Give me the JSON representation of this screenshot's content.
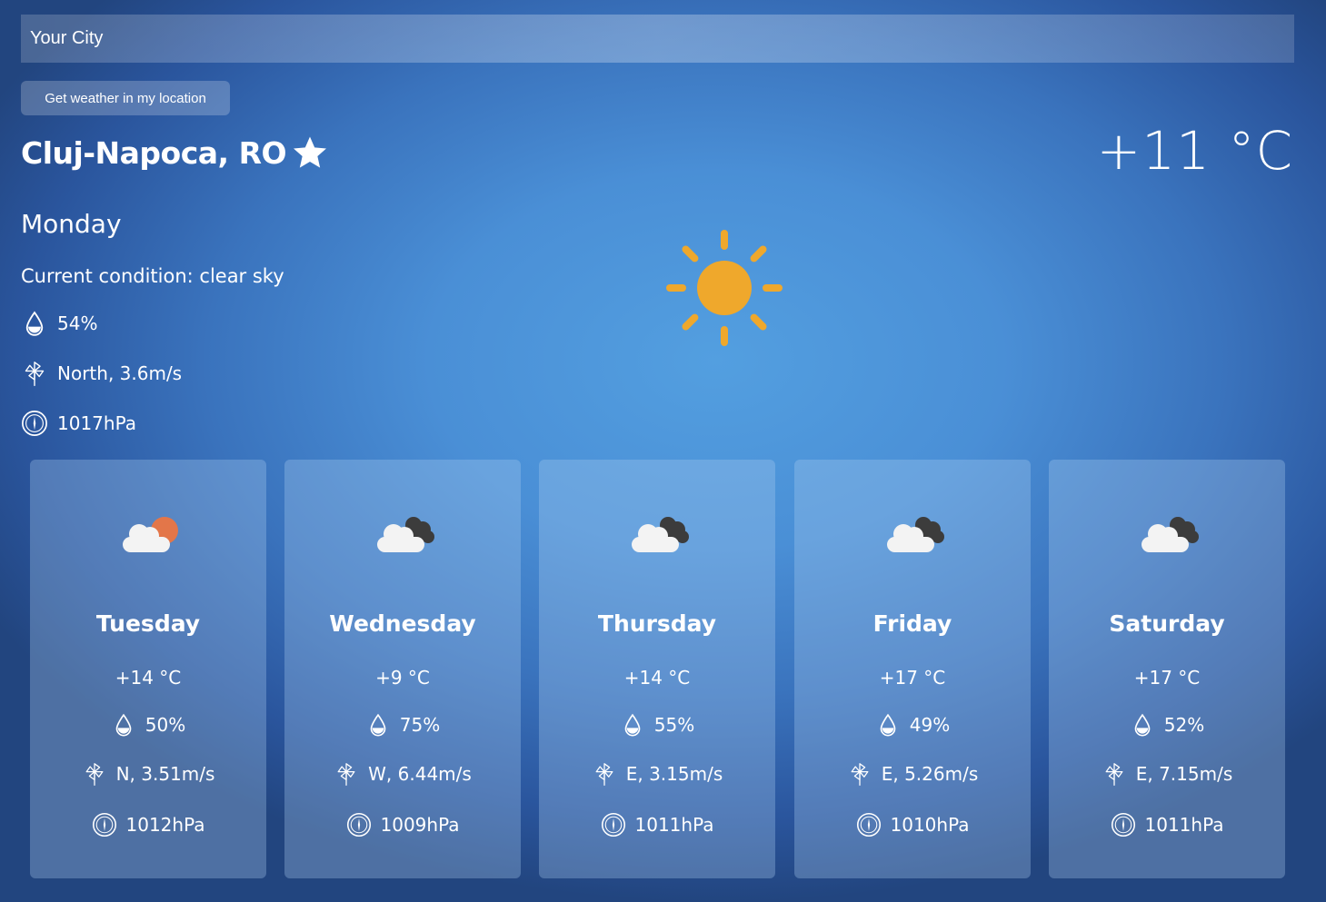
{
  "search": {
    "placeholder": "Your City"
  },
  "location_button": {
    "label": "Get weather in my location"
  },
  "current": {
    "city": "Cluj-Napoca, RO",
    "temperature": "+11 °C",
    "day": "Monday",
    "condition": "Current condition: clear sky",
    "humidity": "54%",
    "wind": "North, 3.6m/s",
    "pressure": "1017hPa",
    "icon": "sun-icon"
  },
  "forecast": [
    {
      "day": "Tuesday",
      "temp": "+14 °C",
      "humidity": "50%",
      "wind": "N, 3.51m/s",
      "pressure": "1012hPa",
      "icon": "cloud-sun-icon"
    },
    {
      "day": "Wednesday",
      "temp": "+9 °C",
      "humidity": "75%",
      "wind": "W, 6.44m/s",
      "pressure": "1009hPa",
      "icon": "cloud-icon"
    },
    {
      "day": "Thursday",
      "temp": "+14 °C",
      "humidity": "55%",
      "wind": "E, 3.15m/s",
      "pressure": "1011hPa",
      "icon": "cloud-icon"
    },
    {
      "day": "Friday",
      "temp": "+17 °C",
      "humidity": "49%",
      "wind": "E, 5.26m/s",
      "pressure": "1010hPa",
      "icon": "cloud-icon"
    },
    {
      "day": "Saturday",
      "temp": "+17 °C",
      "humidity": "52%",
      "wind": "E, 7.15m/s",
      "pressure": "1011hPa",
      "icon": "cloud-icon"
    }
  ],
  "colors": {
    "sun": "#efa82c",
    "sun_behind_cloud": "#e37649",
    "dark_cloud": "#3c3c3c",
    "light_cloud": "#f3f3f3"
  }
}
